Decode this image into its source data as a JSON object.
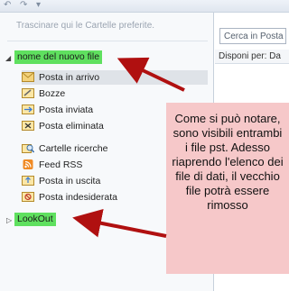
{
  "quick_access": {
    "undo_glyph": "↶",
    "redo_glyph": "↷",
    "dropdown_glyph": "▾"
  },
  "navigation": {
    "favorites_hint": "Trascinare qui le Cartelle preferite.",
    "root_folder": "nome del nuovo file",
    "folders": [
      {
        "label": "Posta in arrivo",
        "icon": "inbox-icon",
        "selected": true
      },
      {
        "label": "Bozze",
        "icon": "drafts-icon"
      },
      {
        "label": "Posta inviata",
        "icon": "sent-icon"
      },
      {
        "label": "Posta eliminata",
        "icon": "deleted-icon"
      },
      {
        "label": "Cartelle ricerche",
        "icon": "search-folder-icon"
      },
      {
        "label": "Feed RSS",
        "icon": "rss-icon"
      },
      {
        "label": "Posta in uscita",
        "icon": "outbox-icon"
      },
      {
        "label": "Posta indesiderata",
        "icon": "junk-icon"
      }
    ],
    "second_root": "LookOut"
  },
  "main_pane": {
    "search_placeholder": "Cerca in Posta",
    "arrange_label": "Disponi per: Da"
  },
  "annotation": {
    "text": "Come si può notare, sono visibili entrambi i file pst. Adesso riaprendo l'elenco dei file di dati, il vecchio file potrà essere rimosso",
    "color": "#f6c8c9",
    "arrow_color": "#b01010"
  }
}
